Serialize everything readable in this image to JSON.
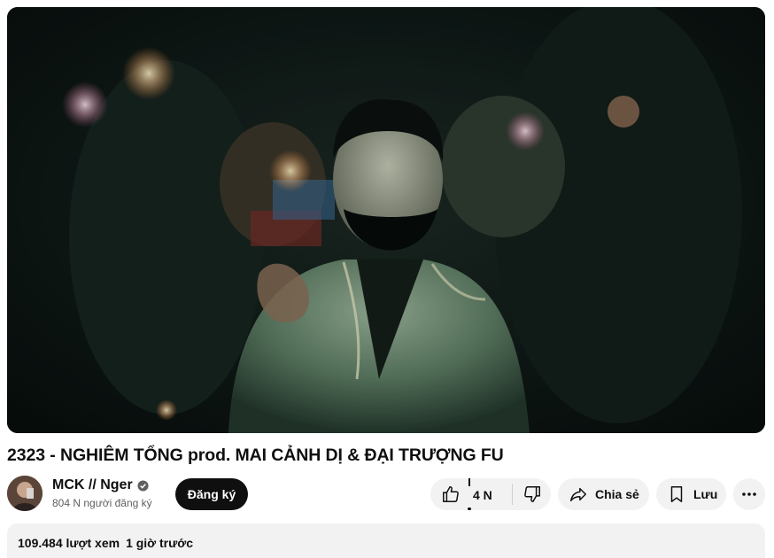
{
  "video": {
    "title": "2323 - NGHIÊM TỔNG prod. MAI CẢNH DỊ & ĐẠI TRƯỢNG FU"
  },
  "channel": {
    "name": "MCK // Nger",
    "subscribers": "804 N người đăng ký",
    "subscribe_label": "Đăng ký"
  },
  "actions": {
    "like_count": "4 N",
    "share_label": "Chia sẻ",
    "save_label": "Lưu"
  },
  "description": {
    "views": "109.484 lượt xem",
    "time": "1 giờ trước"
  },
  "colors": {
    "subscribe_bg": "#0f0f0f",
    "pill_bg": "#f2f2f2",
    "secondary_text": "#606060"
  },
  "icons": [
    "like-icon",
    "dislike-icon",
    "share-icon",
    "save-icon",
    "more-icon",
    "verified-icon"
  ]
}
